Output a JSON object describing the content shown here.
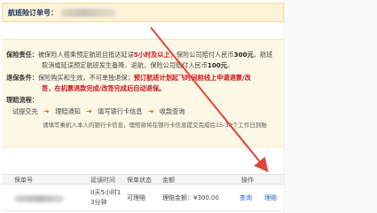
{
  "order": {
    "label": "航班险订单号："
  },
  "insurance": {
    "duty_label": "保险责任：",
    "duty_line1_a": "被保险人搭乘预定航班且抵达延误",
    "duty_line1_red": "5小时及以上",
    "duty_line1_b": "，保险公司赔付人民币",
    "duty_line1_bold": "300元",
    "duty_line1_c": "，航班",
    "duty_line2_a": "取消或延误预定航班发生备降、返航，保险公司赔付人民币",
    "duty_line2_bold": "100元",
    "duty_line2_c": "。",
    "refund_label": "退保条件：",
    "refund_line1_a": "保险购买和生效，不可单独退保；",
    "refund_line1_red": "预订航班计划起飞时间前线上申请退票/改",
    "refund_line2_red": "签，在机票退款完成/改签完成后自动退保。",
    "claim_label": "理赔流程：",
    "steps": [
      "提交理赔",
      "理赔通知",
      "填写银行卡信息",
      "收款查询"
    ],
    "step_first_prefix": "试提交先",
    "note": "请填写乘机人本人的银行卡信息，理赔款将在银行卡信息提交完成后15-30个工作日到账"
  },
  "table": {
    "headers": [
      "保单号",
      "延误时间",
      "保单状态",
      "金额",
      "操作"
    ],
    "row": {
      "delay_line1": "0天5小时1",
      "delay_line2": "3分钟",
      "status": "可理赔",
      "amount": "理赔金额：¥300.00",
      "action_query": "查询",
      "action_claim": "理赔"
    }
  },
  "colors": {
    "accent_red": "#d0121b",
    "link_blue": "#2a62c9",
    "arrow": "#e0433c"
  }
}
